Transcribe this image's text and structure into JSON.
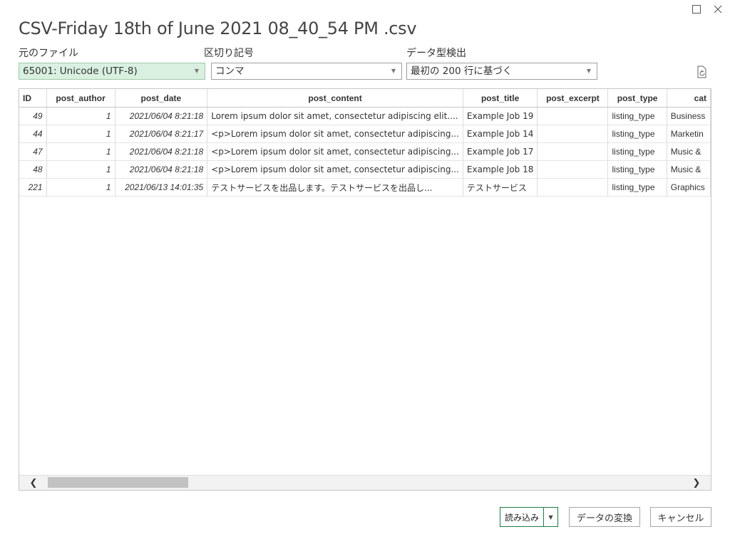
{
  "window": {
    "title": "CSV-Friday 18th of June 2021 08_40_54 PM .csv"
  },
  "controls": {
    "file_origin_label": "元のファイル",
    "file_origin_value": "65001: Unicode (UTF-8)",
    "delimiter_label": "区切り記号",
    "delimiter_value": "コンマ",
    "type_detect_label": "データ型検出",
    "type_detect_value": "最初の 200 行に基づく"
  },
  "table": {
    "columns": [
      "ID",
      "post_author",
      "post_date",
      "post_content",
      "post_title",
      "post_excerpt",
      "post_type",
      "cat"
    ],
    "rows": [
      [
        "49",
        "1",
        "2021/06/04 8:21:18",
        "Lorem ipsum dolor sit amet, consectetur adipiscing elit....",
        "Example Job 19",
        "",
        "listing_type",
        "Business"
      ],
      [
        "44",
        "1",
        "2021/06/04 8:21:17",
        "<p>Lorem ipsum dolor sit amet, consectetur adipiscing...",
        "Example Job 14",
        "",
        "listing_type",
        "Marketin"
      ],
      [
        "47",
        "1",
        "2021/06/04 8:21:18",
        "<p>Lorem ipsum dolor sit amet, consectetur adipiscing...",
        "Example Job 17",
        "",
        "listing_type",
        "Music &"
      ],
      [
        "48",
        "1",
        "2021/06/04 8:21:18",
        "<p>Lorem ipsum dolor sit amet, consectetur adipiscing...",
        "Example Job 18",
        "",
        "listing_type",
        "Music &"
      ],
      [
        "221",
        "1",
        "2021/06/13 14:01:35",
        "テストサービスを出品します。テストサービスを出品し...",
        "テストサービス",
        "",
        "listing_type",
        "Graphics"
      ]
    ]
  },
  "buttons": {
    "load": "読み込み",
    "transform": "データの変換",
    "cancel": "キャンセル"
  },
  "colors": {
    "accent": "#1f7a45",
    "selected_dropdown_bg": "#d9f0e0"
  }
}
